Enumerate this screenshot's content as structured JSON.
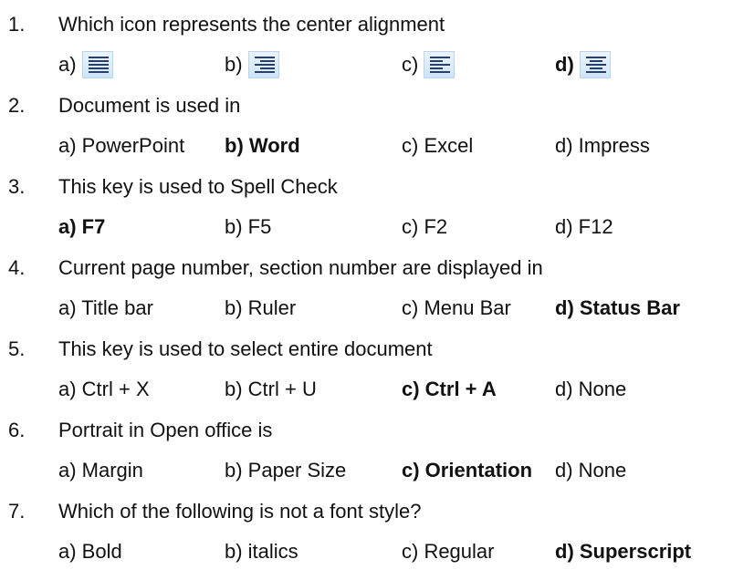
{
  "questions": [
    {
      "number": "1.",
      "text": "Which icon represents the center alignment",
      "options": [
        {
          "label": "a)",
          "icon": "justify-align-icon",
          "bold": false
        },
        {
          "label": "b)",
          "icon": "right-align-icon",
          "bold": false
        },
        {
          "label": "c)",
          "icon": "left-align-icon",
          "bold": false
        },
        {
          "label": "d)",
          "icon": "center-align-icon",
          "bold": true
        }
      ]
    },
    {
      "number": "2.",
      "text": "Document is used in",
      "options": [
        {
          "label": "a) PowerPoint",
          "bold": false
        },
        {
          "label": "b) Word",
          "bold": true
        },
        {
          "label": "c) Excel",
          "bold": false
        },
        {
          "label": "d) Impress",
          "bold": false
        }
      ]
    },
    {
      "number": "3.",
      "text": "This key is used to Spell Check",
      "options": [
        {
          "label": "a) F7",
          "bold": true
        },
        {
          "label": "b) F5",
          "bold": false
        },
        {
          "label": "c) F2",
          "bold": false
        },
        {
          "label": "d) F12",
          "bold": false
        }
      ]
    },
    {
      "number": "4.",
      "text": "Current page number, section number are displayed in",
      "options": [
        {
          "label": "a) Title bar",
          "bold": false
        },
        {
          "label": "b) Ruler",
          "bold": false
        },
        {
          "label": "c) Menu Bar",
          "bold": false
        },
        {
          "label": "d) Status Bar",
          "bold": true
        }
      ]
    },
    {
      "number": "5.",
      "text": "This key is used to select entire document",
      "options": [
        {
          "label": "a) Ctrl + X",
          "bold": false
        },
        {
          "label": "b) Ctrl + U",
          "bold": false
        },
        {
          "label": "c) Ctrl + A",
          "bold": true
        },
        {
          "label": "d) None",
          "bold": false
        }
      ]
    },
    {
      "number": "6.",
      "text": "Portrait in Open office is",
      "options": [
        {
          "label": "a) Margin",
          "bold": false
        },
        {
          "label": "b) Paper Size",
          "bold": false
        },
        {
          "label": "c) Orientation",
          "bold": true
        },
        {
          "label": "d) None",
          "bold": false
        }
      ]
    },
    {
      "number": "7.",
      "text": "Which of the following is not a font style?",
      "options": [
        {
          "label": "a) Bold",
          "bold": false
        },
        {
          "label": "b) italics",
          "bold": false
        },
        {
          "label": "c) Regular",
          "bold": false
        },
        {
          "label": "d) Superscript",
          "bold": true
        }
      ]
    }
  ]
}
